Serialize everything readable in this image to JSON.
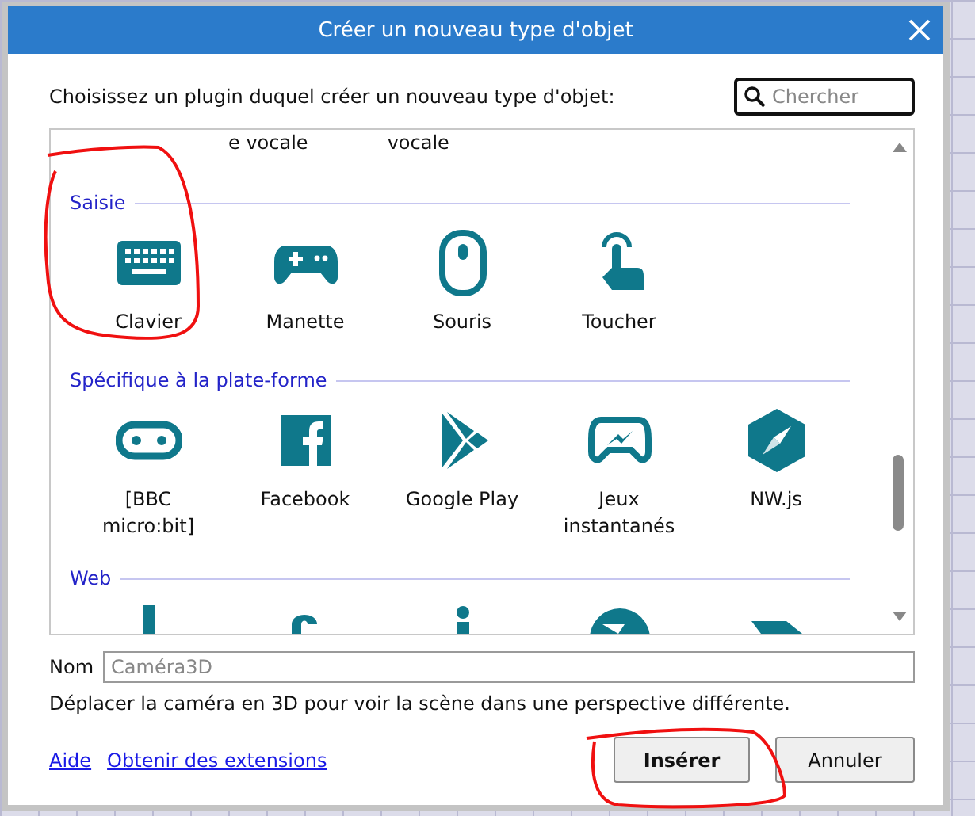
{
  "window": {
    "title": "Créer un nouveau type d'objet"
  },
  "prompt": "Choisissez un plugin duquel créer un nouveau type d'objet:",
  "search": {
    "placeholder": "Chercher"
  },
  "list": {
    "cut_off_labels": [
      "e vocale",
      "vocale"
    ],
    "sections": [
      {
        "title": "Saisie",
        "items": [
          {
            "label": "Clavier",
            "kind": "keyboard"
          },
          {
            "label": "Manette",
            "kind": "gamepad"
          },
          {
            "label": "Souris",
            "kind": "mouse"
          },
          {
            "label": "Toucher",
            "kind": "touch"
          }
        ]
      },
      {
        "title": "Spécifique à la plate-forme",
        "items": [
          {
            "label": "[BBC micro:bit]",
            "kind": "microbit"
          },
          {
            "label": "Facebook",
            "kind": "facebook"
          },
          {
            "label": "Google Play",
            "kind": "play"
          },
          {
            "label": "Jeux instantanés",
            "kind": "instant"
          },
          {
            "label": "NW.js",
            "kind": "compass"
          }
        ]
      },
      {
        "title": "Web",
        "items": [
          {
            "kind": "pillar"
          },
          {
            "kind": "arc"
          },
          {
            "kind": "figure"
          },
          {
            "kind": "globe"
          },
          {
            "kind": "arrow"
          }
        ]
      }
    ]
  },
  "name_field": {
    "label": "Nom",
    "placeholder": "Caméra3D"
  },
  "description": "Déplacer la caméra en 3D pour voir la scène dans une perspective différente.",
  "links": [
    "Aide",
    "Obtenir des extensions"
  ],
  "buttons": [
    {
      "label": "Insérer",
      "primary": true
    },
    {
      "label": "Annuler",
      "primary": false
    }
  ]
}
